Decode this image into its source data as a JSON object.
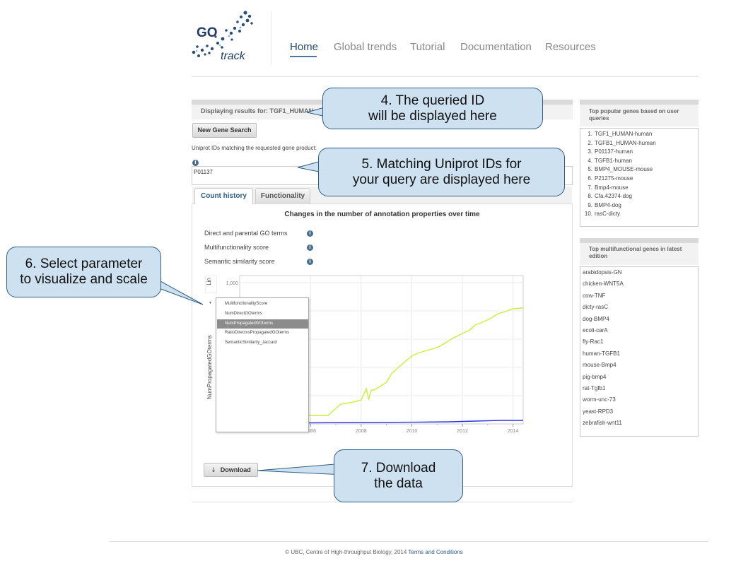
{
  "header": {
    "logo_text_go": "GO",
    "logo_text_track": "track",
    "nav": [
      "Home",
      "Global trends",
      "Tutorial",
      "Documentation",
      "Resources"
    ],
    "active_nav": "Home"
  },
  "main": {
    "displaying_label": "Displaying results for: TGF1_HUMAN",
    "new_search_button": "New Gene Search",
    "uniprot_label": "Uniprot IDs matching the requested gene product:",
    "uniprot_value": "P01137",
    "tabs": [
      "Count history",
      "Functionality"
    ],
    "active_tab": "Count history",
    "chart_heading": "Changes in the number of annotation properties over time",
    "parameters": [
      "Direct and parental GO terms",
      "Multifunctionality score",
      "Semantic similarity score"
    ],
    "scale_label": "Lin",
    "y_axis_label": "NumPropagatedGOterms",
    "dropdown_options": [
      "MultifunctionalityScore",
      "NumDirectGOterms",
      "NumPropagatedGOterms",
      "RatioDirectvsPropagatedGOterms",
      "SemanticSimilarity_Jaccard"
    ],
    "dropdown_selected": "NumPropagatedGOterms",
    "download_button": "Download",
    "download_icon": "download-arrow-icon",
    "info_icon": "info-icon"
  },
  "chart_data": {
    "type": "line",
    "y_tick_labels": [
      "1,000"
    ],
    "x_tick_labels": [
      "2006",
      "2008",
      "2010",
      "2012",
      "2014"
    ],
    "xlim": [
      2003.2,
      2014.4
    ],
    "ylim": [
      0,
      1000
    ],
    "grid": true,
    "series": [
      {
        "color": "#c4f23a",
        "x": [
          2003.2,
          2005.0,
          2005.3,
          2006.0,
          2006.7,
          2006.9,
          2007.2,
          2007.7,
          2008.0,
          2008.2,
          2008.3,
          2008.4,
          2008.5,
          2008.7,
          2009.0,
          2009.2,
          2009.5,
          2009.8,
          2010.0,
          2010.3,
          2010.6,
          2011.0,
          2011.3,
          2011.6,
          2012.0,
          2012.3,
          2012.5,
          2012.8,
          2013.1,
          2013.4,
          2013.7,
          2014.0,
          2014.4
        ],
        "y": [
          5,
          20,
          60,
          60,
          60,
          95,
          140,
          155,
          170,
          250,
          175,
          240,
          240,
          260,
          295,
          355,
          405,
          450,
          480,
          505,
          520,
          540,
          570,
          605,
          640,
          665,
          700,
          720,
          745,
          780,
          795,
          815,
          820
        ]
      },
      {
        "color": "#2f34e0",
        "x": [
          2003.2,
          2006.0,
          2008.0,
          2010.0,
          2011.5,
          2012.5,
          2013.5,
          2014.4
        ],
        "y": [
          5,
          8,
          10,
          12,
          15,
          20,
          25,
          25
        ]
      }
    ]
  },
  "sidebar": {
    "popular_title": "Top popular genes based on user queries",
    "popular": [
      "TGF1_HUMAN-human",
      "TGFB1_HUMAN-human",
      "P01137-human",
      "TGFB1-human",
      "BMP4_MOUSE-mouse",
      "P21275-mouse",
      "Bmp4-mouse",
      "Cfa.42374-dog",
      "BMP4-dog",
      "rasC-dicty"
    ],
    "multifunctional_title": "Top multifunctional genes in latest edition",
    "multifunctional": [
      "arabidopsis-GN",
      "chicken-WNT5A",
      "cow-TNF",
      "dicty-rasC",
      "dog-BMP4",
      "ecoli-carA",
      "fly-Rac1",
      "human-TGFB1",
      "mouse-Bmp4",
      "pig-bmp4",
      "rat-Tgfb1",
      "worm-unc-73",
      "yeast-RPD3",
      "zebrafish-wnt11"
    ]
  },
  "callouts": {
    "c4": "4. The queried ID\nwill be displayed here",
    "c5": "5. Matching Uniprot IDs for\nyour query are displayed here",
    "c6": "6. Select parameter\nto visualize and scale",
    "c7": "7. Download\nthe data"
  },
  "footer": {
    "text": "© UBC, Centre of High-throughput Biology, 2014",
    "link": "Terms and Conditions"
  },
  "colors": {
    "callout_fill": "#cde1f0",
    "callout_border": "#2f5f86",
    "accent": "#2b5f8c"
  }
}
